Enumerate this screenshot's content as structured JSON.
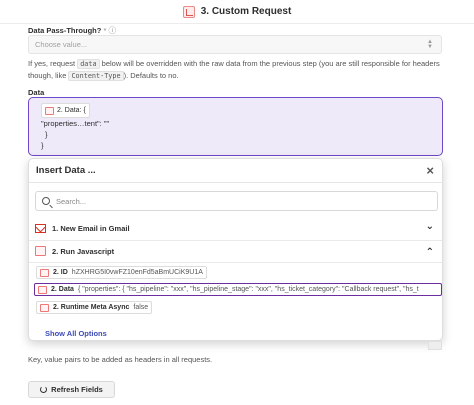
{
  "header": {
    "title": "3. Custom Request"
  },
  "pass_through": {
    "label": "Data Pass-Through?",
    "marker": "* ⓘ",
    "placeholder": "Choose value..."
  },
  "help": {
    "before": "If yes, request",
    "code1": "data",
    "middle": "below will be overridden with the raw data from the previous step (you are still responsible for headers though, like",
    "code2": "Content-Type",
    "after": "). Defaults to no."
  },
  "data_field": {
    "label": "Data",
    "pill_text": "2. Data: {",
    "line2": "\"properties…tent\": \"\"",
    "line3": "}",
    "line4": "}"
  },
  "insert_data": {
    "title": "Insert Data ...",
    "close_icon": "×",
    "search_placeholder": "Search...",
    "sections": [
      {
        "label": "1. New Email in Gmail",
        "chevron": "⌄"
      },
      {
        "label": "2. Run Javascript",
        "chevron": "⌃"
      }
    ],
    "items": [
      {
        "key": "2. ID",
        "value": "hZXHRG5I0vwFZ10enFd5aBmUCiK9U1A"
      },
      {
        "key": "2. Data",
        "value": "{ \"properties\": { \"hs_pipeline\": \"xxx\", \"hs_pipeline_stage\": \"xxx\", \"hs_ticket_category\": \"Callback request\", \"hs_t"
      },
      {
        "key": "2. Runtime Meta Async",
        "value": "false"
      }
    ],
    "show_all": "Show All Options"
  },
  "footer": {
    "headers_help": "Key, value pairs to be added as headers in all requests.",
    "refresh_label": "Refresh Fields"
  }
}
